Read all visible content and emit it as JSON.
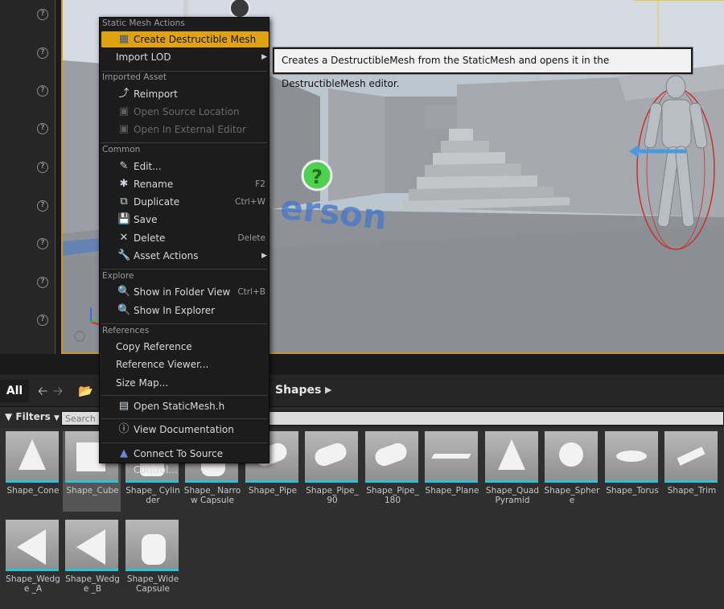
{
  "left_panel": {
    "help_icon_count": 9
  },
  "viewport": {
    "floor_text": "erson",
    "help_marker": "?"
  },
  "context_menu": {
    "sections": {
      "static_mesh_actions": "Static Mesh Actions",
      "imported_asset": "Imported Asset",
      "common": "Common",
      "explore": "Explore",
      "references": "References"
    },
    "items": {
      "create_destructible": "Create Destructible Mesh",
      "import_lod": "Import LOD",
      "reimport": "Reimport",
      "open_source_location": "Open Source Location",
      "open_external_editor": "Open In External Editor",
      "edit": "Edit...",
      "rename": "Rename",
      "duplicate": "Duplicate",
      "save": "Save",
      "delete": "Delete",
      "asset_actions": "Asset Actions",
      "show_folder_view": "Show in Folder View",
      "show_explorer": "Show In Explorer",
      "copy_reference": "Copy Reference",
      "reference_viewer": "Reference Viewer...",
      "size_map": "Size Map...",
      "open_staticmesh_h": "Open StaticMesh.h",
      "view_documentation": "View Documentation",
      "connect_source_control": "Connect To Source Control..."
    },
    "shortcuts": {
      "rename": "F2",
      "duplicate": "Ctrl+W",
      "delete": "Delete",
      "show_folder_view": "Ctrl+B"
    }
  },
  "tooltip": {
    "text": "Creates a DestructibleMesh from the StaticMesh and opens it in the DestructibleMesh editor."
  },
  "content_browser": {
    "all_label": "All",
    "breadcrumb": "Shapes",
    "filters_label": "Filters",
    "search_placeholder": "Search Shapes",
    "assets": [
      "Shape_Cone",
      "Shape_Cube",
      "Shape_ Cylinder",
      "Shape_ Narrow Capsule",
      "Shape_Pipe",
      "Shape_Pipe_ 90",
      "Shape_Pipe_ 180",
      "Shape_Plane",
      "Shape_Quad Pyramid",
      "Shape_Sphere",
      "Shape_Torus",
      "Shape_Trim",
      "Shape_Wedge _A",
      "Shape_Wedge _B",
      "Shape_Wide Capsule"
    ],
    "selected_index": 1
  },
  "colors": {
    "highlight": "#e0a30f",
    "viewport_border": "#c79b1f",
    "asset_underline": "#2bc3d8"
  }
}
